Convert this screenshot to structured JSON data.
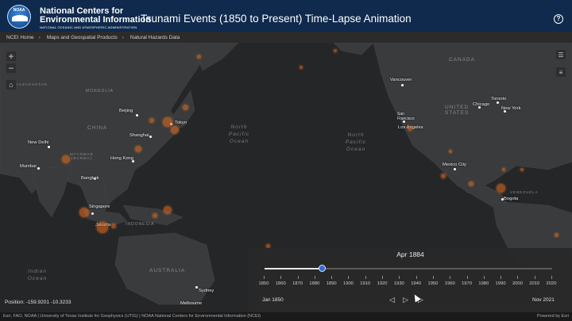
{
  "header": {
    "org_line1": "National Centers for",
    "org_line2": "Environmental Information",
    "org_sub": "NATIONAL OCEANIC AND ATMOSPHERIC ADMINISTRATION",
    "logo_text": "NOAA",
    "app_title": "Tsunami Events (1850 to Present) Time-Lapse Animation",
    "help_icon": "help-icon"
  },
  "breadcrumb": [
    "NCEI Home",
    "Maps and Geospatial Products",
    "Natural Hazards Data"
  ],
  "map_controls": {
    "zoom_in": "+",
    "zoom_out": "−",
    "home_icon": "home-icon",
    "layers_icon": "layer-list-icon",
    "legend_icon": "legend-icon"
  },
  "map_labels": {
    "regions": [
      "CANADA",
      "UNITED STATES",
      "CHINA",
      "MONGOLIA",
      "MYANMAR (BURMA)",
      "INDONESIA",
      "AUSTRALIA",
      "VENEZUELA",
      "KAZAKHSTAN"
    ],
    "oceans": [
      "North Pacific Ocean",
      "North Pacific Ocean",
      "Indian Ocean"
    ],
    "cities": [
      "Beijing",
      "Shanghai",
      "Tokyo",
      "Hong Kong",
      "New Delhi",
      "Mumbai",
      "Bangkok",
      "Singapore",
      "Jakarta",
      "Sydney",
      "Melbourne",
      "Vancouver",
      "San Francisco",
      "Los Angeles",
      "Chicago",
      "Toronto",
      "New York",
      "Mexico City",
      "Bogota"
    ]
  },
  "time_slider": {
    "current_date": "Apr 1884",
    "ticks": [
      "1850",
      "1860",
      "1870",
      "1880",
      "1890",
      "1900",
      "1910",
      "1920",
      "1930",
      "1940",
      "1950",
      "1960",
      "1970",
      "1980",
      "1990",
      "2000",
      "2010",
      "2020"
    ],
    "start_label": "Jan 1850",
    "end_label": "Nov 2021",
    "progress": 0.2
  },
  "position_text": "Position: -159.9201 -10.3233",
  "footer": {
    "attribution": "Esri, FAO, NOAA | University of Texas Institute for Geophysics (UTIG) | NOAA National Centers for Environmental Information (NCEI)",
    "powered_by": "Powered by Esri"
  },
  "colors": {
    "header_bg": "#0f2a4d",
    "map_bg": "#252628",
    "event_marker": "#e96e1e",
    "slider_thumb": "#2d6bd8"
  }
}
